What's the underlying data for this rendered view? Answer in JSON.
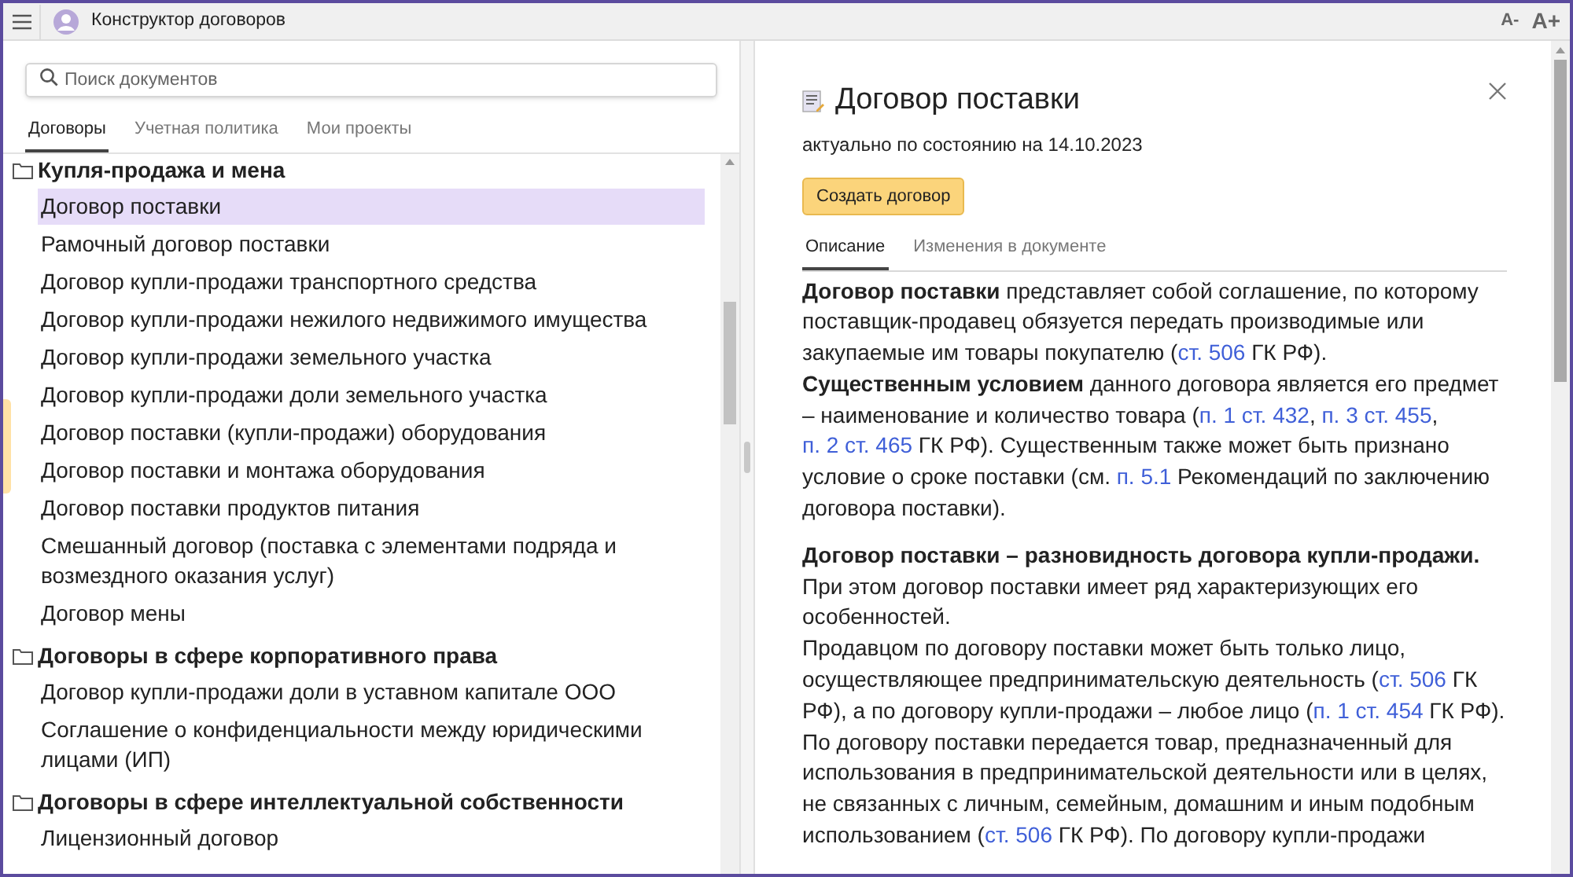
{
  "window": {
    "title": "Конструктор договоров",
    "font_buttons": [
      "A-",
      "A+"
    ]
  },
  "search": {
    "placeholder": "Поиск документов"
  },
  "left_tabs": [
    {
      "label": "Договоры",
      "selected": true
    },
    {
      "label": "Учетная политика",
      "selected": false
    },
    {
      "label": "Мои проекты",
      "selected": false
    }
  ],
  "tree": [
    {
      "title": "Купля-продажа и мена",
      "children": [
        {
          "label": "Договор поставки",
          "selected": true
        },
        {
          "label": "Рамочный договор поставки",
          "selected": false
        },
        {
          "label": "Договор купли-продажи транспортного средства",
          "selected": false
        },
        {
          "label": "Договор купли-продажи нежилого недвижимого имущества",
          "selected": false
        },
        {
          "label": "Договор купли-продажи земельного участка",
          "selected": false
        },
        {
          "label": "Договор купли-продажи доли земельного участка",
          "selected": false
        },
        {
          "label": "Договор поставки (купли-продажи) оборудования",
          "selected": false
        },
        {
          "label": "Договор поставки и монтажа оборудования",
          "selected": false
        },
        {
          "label": "Договор поставки продуктов питания",
          "selected": false
        },
        {
          "label": "Смешанный договор (поставка с элементами подряда и возмездного оказания услуг)",
          "selected": false
        },
        {
          "label": "Договор мены",
          "selected": false
        }
      ]
    },
    {
      "title": "Договоры в сфере корпоративного права",
      "children": [
        {
          "label": "Договор купли-продажи доли в уставном капитале ООО",
          "selected": false
        },
        {
          "label": "Соглашение о конфиденциальности между юридическими лицами (ИП)",
          "selected": false
        }
      ]
    },
    {
      "title": "Договоры в сфере интеллектуальной собственности",
      "children": [
        {
          "label": "Лицензионный договор",
          "selected": false
        }
      ]
    }
  ],
  "document": {
    "title": "Договор поставки",
    "date": "актуально по состоянию на 14.10.2023",
    "create_button": "Создать договор",
    "tabs": [
      {
        "label": "Описание",
        "selected": true
      },
      {
        "label": "Изменения в документе",
        "selected": false
      }
    ],
    "sections": [
      [
        {
          "parts": [
            {
              "kind": "bold",
              "text": "Договор поставки"
            },
            {
              "kind": "text",
              "text": " представляет собой соглашение, по которому поставщик-продавец обязуется передать производимые или закупаемые им товары покупателю ("
            },
            {
              "kind": "link",
              "text": "ст. 506"
            },
            {
              "kind": "text",
              "text": " ГК РФ)."
            }
          ]
        },
        {
          "parts": [
            {
              "kind": "bold",
              "text": "Существенным условием"
            },
            {
              "kind": "text",
              "text": " данного договора является его предмет – наименование и количество товара ("
            },
            {
              "kind": "link",
              "text": "п. 1 ст. 432"
            },
            {
              "kind": "text",
              "text": ", "
            },
            {
              "kind": "link",
              "text": "п. 3 ст. 455"
            },
            {
              "kind": "text",
              "text": ", "
            },
            {
              "kind": "link",
              "text": "п. 2 ст. 465"
            },
            {
              "kind": "text",
              "text": " ГК РФ). Существенным также может быть признано условие о сроке поставки (см. "
            },
            {
              "kind": "link",
              "text": "п. 5.1"
            },
            {
              "kind": "text",
              "text": " Рекомендаций по заключению договора поставки)."
            }
          ]
        }
      ],
      [
        {
          "parts": [
            {
              "kind": "bold",
              "text": "Договор поставки – разновидность договора купли-продажи."
            }
          ]
        },
        {
          "parts": [
            {
              "kind": "text",
              "text": "При этом договор поставки имеет ряд характеризующих его особенностей."
            }
          ]
        },
        {
          "parts": [
            {
              "kind": "text",
              "text": "Продавцом по договору поставки может быть только лицо, осуществляющее предпринимательскую деятельность ("
            },
            {
              "kind": "link",
              "text": "ст. 506"
            },
            {
              "kind": "text",
              "text": " ГК РФ), а по договору купли-продажи – любое лицо ("
            },
            {
              "kind": "link",
              "text": "п. 1 ст. 454"
            },
            {
              "kind": "text",
              "text": " ГК РФ)."
            }
          ]
        },
        {
          "parts": [
            {
              "kind": "text",
              "text": "По договору поставки передается товар, предназначенный для использования в предпринимательской деятельности или в целях, не связанных с личным, семейным, домашним и иным подобным использованием ("
            },
            {
              "kind": "link",
              "text": "ст. 506"
            },
            {
              "kind": "text",
              "text": " ГК РФ). По договору купли-продажи"
            }
          ]
        }
      ]
    ]
  }
}
